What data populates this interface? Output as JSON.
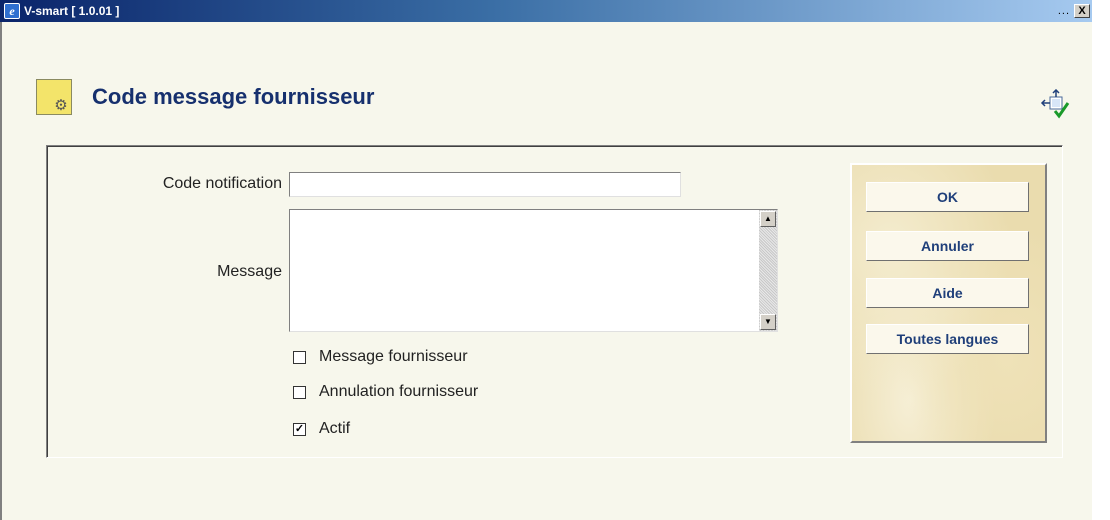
{
  "window": {
    "title": "V-smart [ 1.0.01 ]",
    "dots": "...",
    "close_label": "X"
  },
  "header": {
    "title": "Code message fournisseur"
  },
  "form": {
    "code_label": "Code notification",
    "code_value": "",
    "message_label": "Message",
    "message_value": "",
    "checkboxes": [
      {
        "label": "Message fournisseur",
        "checked": false
      },
      {
        "label": "Annulation fournisseur",
        "checked": false
      },
      {
        "label": "Actif",
        "checked": true
      }
    ]
  },
  "actions": {
    "ok": "OK",
    "cancel": "Annuler",
    "help": "Aide",
    "all_languages": "Toutes langues"
  },
  "colors": {
    "title_blue": "#16306e",
    "button_text": "#1f3f7a",
    "background": "#f7f7ec"
  },
  "icons": [
    "app-icon",
    "settings-page-icon",
    "sync-icon",
    "scroll-up-icon",
    "scroll-down-icon"
  ]
}
